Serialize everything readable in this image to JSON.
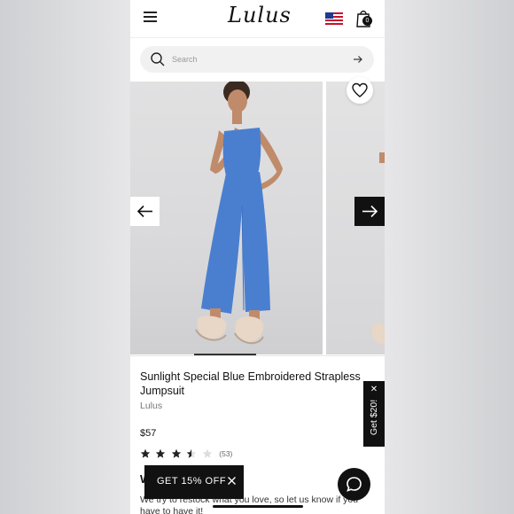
{
  "header": {
    "logo_text": "Lulus",
    "cart_count": "0",
    "menu_icon": "hamburger-menu-icon",
    "flag_icon": "us-flag-icon",
    "cart_icon": "shopping-bag-icon"
  },
  "search": {
    "placeholder": "Search",
    "icon": "search-icon",
    "submit_icon": "arrow-right-icon"
  },
  "gallery": {
    "prev_icon": "arrow-left-icon",
    "next_icon": "arrow-right-icon",
    "wishlist_icon": "heart-icon",
    "dress_color": "#4a7fd0"
  },
  "product": {
    "title": "Sunlight Special Blue Embroidered Strapless Jumpsuit",
    "brand": "Lulus",
    "price": "$57",
    "rating": 3.5,
    "rating_max": 5,
    "review_count": "(53)"
  },
  "get20": {
    "label": "Get $20!",
    "close": "✕"
  },
  "section": {
    "heading_visible": "W",
    "restock_text": "We try to restock what you love, so let us know if you have to have it!"
  },
  "promo": {
    "label": "GET 15% OFF",
    "close_icon": "close-icon"
  },
  "chat": {
    "icon": "chat-bubble-icon"
  }
}
